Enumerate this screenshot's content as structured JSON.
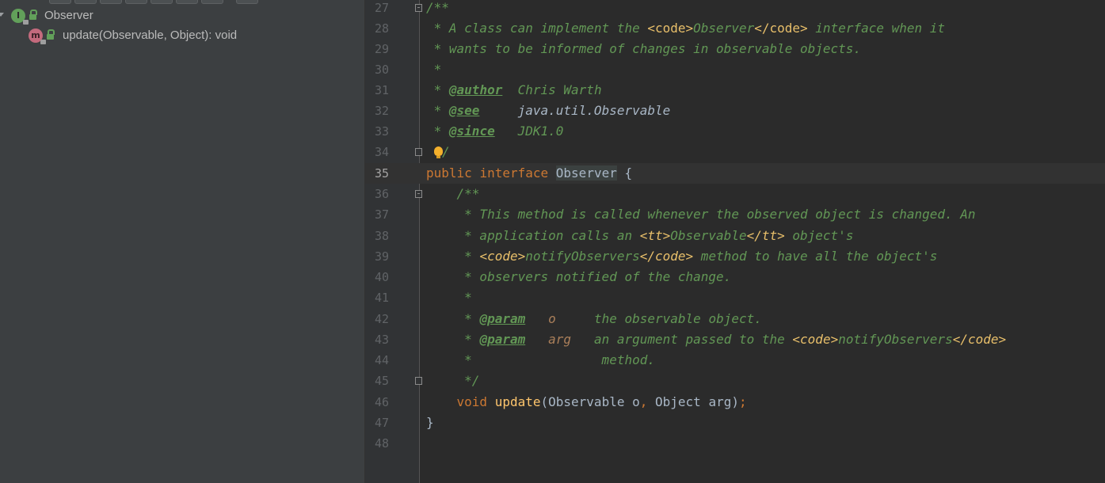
{
  "structure": {
    "class_node": {
      "label": "Observer",
      "icon_letter": "I"
    },
    "method_node": {
      "label": "update(Observable, Object): void",
      "icon_letter": "m"
    }
  },
  "editor": {
    "lines": [
      {
        "n": "27"
      },
      {
        "n": "28"
      },
      {
        "n": "29"
      },
      {
        "n": "30"
      },
      {
        "n": "31"
      },
      {
        "n": "32"
      },
      {
        "n": "33"
      },
      {
        "n": "34"
      },
      {
        "n": "35"
      },
      {
        "n": "36"
      },
      {
        "n": "37"
      },
      {
        "n": "38"
      },
      {
        "n": "39"
      },
      {
        "n": "40"
      },
      {
        "n": "41"
      },
      {
        "n": "42"
      },
      {
        "n": "43"
      },
      {
        "n": "44"
      },
      {
        "n": "45"
      },
      {
        "n": "46"
      },
      {
        "n": "47"
      },
      {
        "n": "48"
      }
    ],
    "code": {
      "l27": "/**",
      "l28a": " * A class can implement the ",
      "l28b": "<code>",
      "l28c": "Observer",
      "l28d": "</code>",
      "l28e": " interface when it",
      "l29": " * wants to be informed of changes in observable objects.",
      "l30": " *",
      "l31a": " * ",
      "l31b": "@author",
      "l31c": "  Chris Warth",
      "l32a": " * ",
      "l32b": "@see",
      "l32c": "     java.util.Observable",
      "l33a": " * ",
      "l33b": "@since",
      "l33c": "   JDK1.0",
      "l34": "/",
      "l35a": "public",
      "l35b": " ",
      "l35c": "interface",
      "l35d": " ",
      "l35e": "Observer",
      "l35f": " {",
      "l36": "    /**",
      "l37": "     * This method is called whenever the observed object is changed. An",
      "l38a": "     * application calls an ",
      "l38b": "<tt>",
      "l38c": "Observable",
      "l38d": "</tt>",
      "l38e": " object's",
      "l39a": "     * ",
      "l39b": "<code>",
      "l39c": "notifyObservers",
      "l39d": "</code>",
      "l39e": " method to have all the object's",
      "l40": "     * observers notified of the change.",
      "l41": "     *",
      "l42a": "     * ",
      "l42b": "@param",
      "l42c": "   ",
      "l42d": "o",
      "l42e": "     the observable object.",
      "l43a": "     * ",
      "l43b": "@param",
      "l43c": "   ",
      "l43d": "arg",
      "l43e": "   an argument passed to the ",
      "l43f": "<code>",
      "l43g": "notifyObservers",
      "l43h": "</code>",
      "l44": "     *                 method.",
      "l45": "     */",
      "l46a": "    ",
      "l46b": "void",
      "l46c": " ",
      "l46d": "update",
      "l46e": "(Observable o",
      "l46f": ",",
      "l46g": " Object arg)",
      "l46h": ";",
      "l47": "}"
    },
    "current_line": "35"
  }
}
